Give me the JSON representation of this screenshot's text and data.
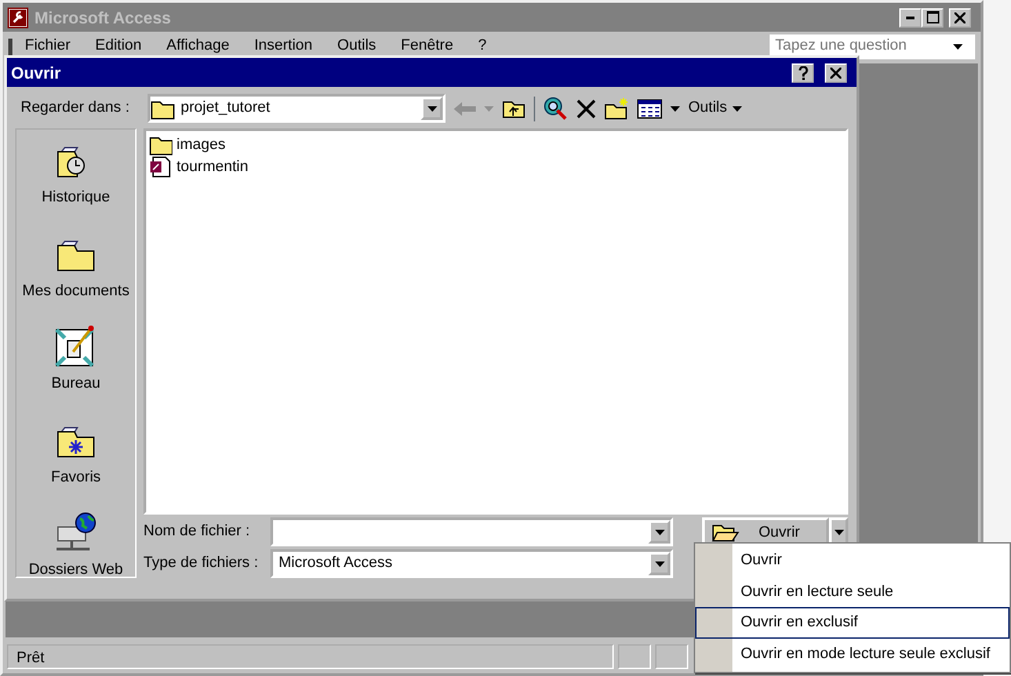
{
  "app_window": {
    "title": "Microsoft Access",
    "active": false
  },
  "menu_bar": [
    "Fichier",
    "Edition",
    "Affichage",
    "Insertion",
    "Outils",
    "Fenêtre",
    "?"
  ],
  "question_box": {
    "placeholder": "Tapez une question"
  },
  "dialog": {
    "title": "Ouvrir",
    "look_in_label": "Regarder dans :",
    "look_in_value": "projet_tutoret",
    "tools_label": "Outils",
    "places": [
      {
        "label": "Historique",
        "kind": "history"
      },
      {
        "label": "Mes documents",
        "kind": "documents"
      },
      {
        "label": "Bureau",
        "kind": "desktop"
      },
      {
        "label": "Favoris",
        "kind": "favorites"
      },
      {
        "label": "Dossiers Web",
        "kind": "web"
      }
    ],
    "files": [
      {
        "name": "images",
        "kind": "folder"
      },
      {
        "name": "tourmentin",
        "kind": "access"
      }
    ],
    "file_name_label": "Nom de fichier :",
    "file_type_label": "Type de fichiers :",
    "file_type_value": "Microsoft Access",
    "open_button": "Ouvrir"
  },
  "open_menu": [
    {
      "label": "Ouvrir",
      "selected": false
    },
    {
      "label": "Ouvrir en lecture seule",
      "selected": false
    },
    {
      "label": "Ouvrir en exclusif",
      "selected": true
    },
    {
      "label": "Ouvrir en mode lecture seule exclusif",
      "selected": false
    }
  ],
  "status_bar": {
    "text": "Prêt"
  }
}
